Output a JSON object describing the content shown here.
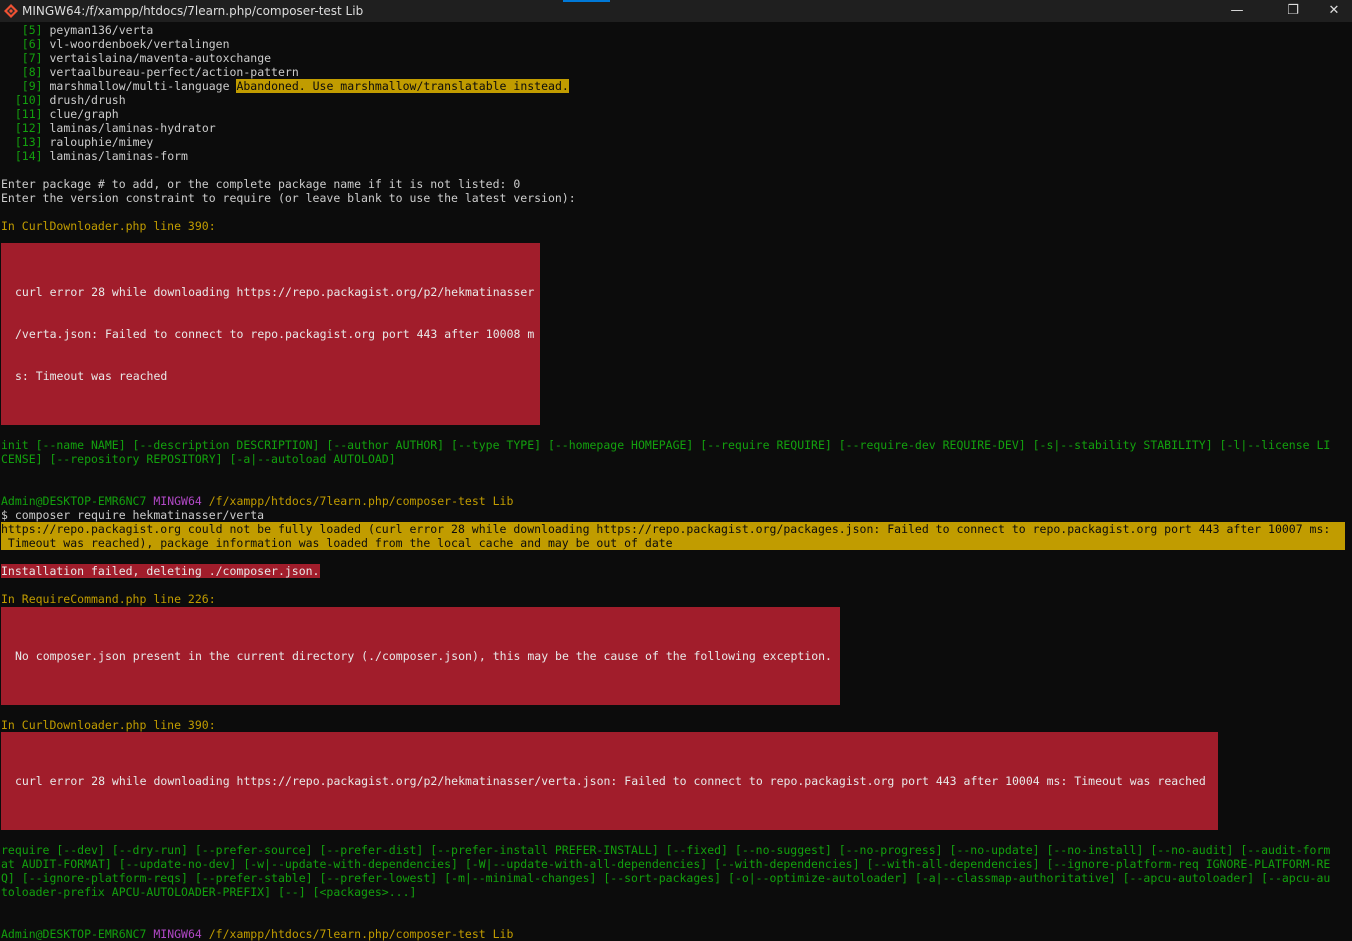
{
  "window": {
    "title": "MINGW64:/f/xampp/htdocs/7learn.php/composer-test Lib",
    "minimize_glyph": "—",
    "maximize_glyph": "❐",
    "close_glyph": "✕"
  },
  "packages": [
    {
      "num": "[5]",
      "name": "peyman136/verta",
      "note": ""
    },
    {
      "num": "[6]",
      "name": "vl-woordenboek/vertalingen",
      "note": ""
    },
    {
      "num": "[7]",
      "name": "vertaislaina/maventa-autoxchange",
      "note": ""
    },
    {
      "num": "[8]",
      "name": "vertaalbureau-perfect/action-pattern",
      "note": ""
    },
    {
      "num": "[9]",
      "name": "marshmallow/multi-language",
      "note": "Abandoned. Use marshmallow/translatable instead."
    },
    {
      "num": "[10]",
      "name": "drush/drush",
      "note": ""
    },
    {
      "num": "[11]",
      "name": "clue/graph",
      "note": ""
    },
    {
      "num": "[12]",
      "name": "laminas/laminas-hydrator",
      "note": ""
    },
    {
      "num": "[13]",
      "name": "ralouphie/mimey",
      "note": ""
    },
    {
      "num": "[14]",
      "name": "laminas/laminas-form",
      "note": ""
    }
  ],
  "prompt_add": "Enter package # to add, or the complete package name if it is not listed: 0",
  "prompt_version": "Enter the version constraint to require (or leave blank to use the latest version):",
  "err1_header": "In CurlDownloader.php line 390:",
  "err1_lines": [
    "curl error 28 while downloading https://repo.packagist.org/p2/hekmatinasser",
    "/verta.json: Failed to connect to repo.packagist.org port 443 after 10008 m",
    "s: Timeout was reached"
  ],
  "init_usage": [
    "init [--name NAME] [--description DESCRIPTION] [--author AUTHOR] [--type TYPE] [--homepage HOMEPAGE] [--require REQUIRE] [--require-dev REQUIRE-DEV] [-s|--stability STABILITY] [-l|--license LI",
    "CENSE] [--repository REPOSITORY] [-a|--autoload AUTOLOAD]"
  ],
  "prompt1": {
    "user": "Admin@DESKTOP-EMR6NC7",
    "shell": "MINGW64",
    "path": "/f/xampp/htdocs/7learn.php/composer-test Lib"
  },
  "command": "$ composer require hekmatinasser/verta",
  "warning_lines": [
    "https://repo.packagist.org could not be fully loaded (curl error 28 while downloading https://repo.packagist.org/packages.json: Failed to connect to repo.packagist.org port 443 after 10007 ms:",
    " Timeout was reached), package information was loaded from the local cache and may be out of date"
  ],
  "install_failed": "Installation failed, deleting ./composer.json.",
  "err2_header": "In RequireCommand.php line 226:",
  "err2_lines": [
    "No composer.json present in the current directory (./composer.json), this may be the cause of the following exception."
  ],
  "err3_header": "In CurlDownloader.php line 390:",
  "err3_lines": [
    "curl error 28 while downloading https://repo.packagist.org/p2/hekmatinasser/verta.json: Failed to connect to repo.packagist.org port 443 after 10004 ms: Timeout was reached"
  ],
  "require_usage": [
    "require [--dev] [--dry-run] [--prefer-source] [--prefer-dist] [--prefer-install PREFER-INSTALL] [--fixed] [--no-suggest] [--no-progress] [--no-update] [--no-install] [--no-audit] [--audit-form",
    "at AUDIT-FORMAT] [--update-no-dev] [-w|--update-with-dependencies] [-W|--update-with-all-dependencies] [--with-dependencies] [--with-all-dependencies] [--ignore-platform-req IGNORE-PLATFORM-RE",
    "Q] [--ignore-platform-reqs] [--prefer-stable] [--prefer-lowest] [-m|--minimal-changes] [--sort-packages] [-o|--optimize-autoloader] [-a|--classmap-authoritative] [--apcu-autoloader] [--apcu-au",
    "toloader-prefix APCU-AUTOLOADER-PREFIX] [--] [<packages>...]"
  ],
  "prompt2": {
    "user": "Admin@DESKTOP-EMR6NC7",
    "shell": "MINGW64",
    "path": "/f/xampp/htdocs/7learn.php/composer-test Lib"
  }
}
